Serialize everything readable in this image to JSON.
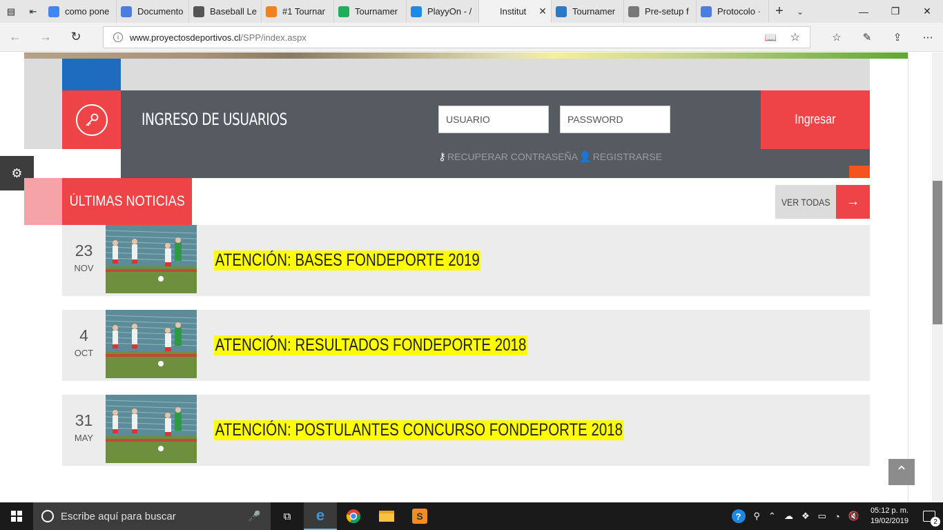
{
  "browser": {
    "tabs": [
      {
        "title": "como pone",
        "favicon": "google-icon",
        "color": "#4285f4"
      },
      {
        "title": "Documento",
        "favicon": "docs-icon",
        "color": "#4a7fe0"
      },
      {
        "title": "Baseball Le",
        "favicon": "baseball-icon",
        "color": "#555555"
      },
      {
        "title": "#1 Tournar",
        "favicon": "star-badge-icon",
        "color": "#f4811f"
      },
      {
        "title": "Tournamer",
        "favicon": "t-logo-icon",
        "color": "#1fae5a"
      },
      {
        "title": "PlayyOn - /",
        "favicon": "playyon-icon",
        "color": "#1e88e5"
      },
      {
        "title": "Institut",
        "favicon": "none",
        "color": "#f2f2f2",
        "active": true
      },
      {
        "title": "Tournamer",
        "favicon": "shield-icon",
        "color": "#2b78c5"
      },
      {
        "title": "Pre-setup f",
        "favicon": "sheet-icon",
        "color": "#777777"
      },
      {
        "title": "Protocolo ·",
        "favicon": "docs-icon",
        "color": "#4a7fe0"
      }
    ],
    "url": {
      "domain": "www.proyectosdeportivos.cl",
      "path": "/SPP/index.aspx"
    }
  },
  "login": {
    "title": "INGRESO DE USUARIOS",
    "user_placeholder": "USUARIO",
    "pass_placeholder": "PASSWORD",
    "submit_label": "Ingresar",
    "recover_label": "RECUPERAR CONTRASEÑA",
    "register_label": "REGISTRARSE"
  },
  "news": {
    "heading": "ÚLTIMAS NOTICIAS",
    "view_all": "VER TODAS",
    "items": [
      {
        "day": "23",
        "month": "NOV",
        "title": "ATENCIÓN: BASES FONDEPORTE 2019"
      },
      {
        "day": "4",
        "month": "OCT",
        "title": "ATENCIÓN: RESULTADOS FONDEPORTE 2018"
      },
      {
        "day": "31",
        "month": "MAY",
        "title": "ATENCIÓN: POSTULANTES CONCURSO FONDEPORTE 2018"
      }
    ]
  },
  "colors": {
    "accent_red": "#ee4447",
    "panel_grey": "#565a61",
    "highlight_yellow": "#ffff00",
    "blue_block": "#1e6cbf",
    "orange": "#f4541e"
  },
  "taskbar": {
    "search_placeholder": "Escribe aquí para buscar",
    "time": "05:12 p. m.",
    "date": "19/02/2019",
    "notification_count": "2"
  }
}
